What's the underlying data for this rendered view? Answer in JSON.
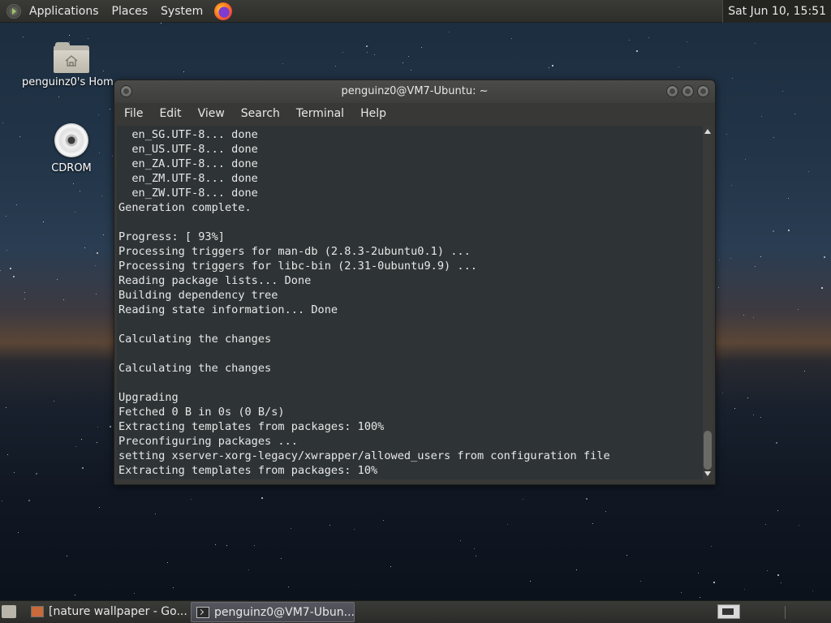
{
  "top_panel": {
    "menus": [
      "Applications",
      "Places",
      "System"
    ],
    "icons": [
      "mint-menu-icon",
      "firefox-icon"
    ],
    "clock": "Sat Jun 10, 15:51"
  },
  "desktop": {
    "icons": [
      {
        "label": "penguinz0's Hom",
        "icon": "home-folder-icon"
      },
      {
        "label": "CDROM",
        "icon": "cdrom-icon"
      }
    ]
  },
  "terminal": {
    "title": "penguinz0@VM7-Ubuntu: ~",
    "menu": [
      "File",
      "Edit",
      "View",
      "Search",
      "Terminal",
      "Help"
    ],
    "lines": [
      "  en_SG.UTF-8... done",
      "  en_US.UTF-8... done",
      "  en_ZA.UTF-8... done",
      "  en_ZM.UTF-8... done",
      "  en_ZW.UTF-8... done",
      "Generation complete.",
      "",
      "Progress: [ 93%]",
      "Processing triggers for man-db (2.8.3-2ubuntu0.1) ...",
      "Processing triggers for libc-bin (2.31-0ubuntu9.9) ...",
      "Reading package lists... Done",
      "Building dependency tree",
      "Reading state information... Done",
      "",
      "Calculating the changes",
      "",
      "Calculating the changes",
      "",
      "Upgrading",
      "Fetched 0 B in 0s (0 B/s)",
      "Extracting templates from packages: 100%",
      "Preconfiguring packages ...",
      "setting xserver-xorg-legacy/xwrapper/allowed_users from configuration file",
      "Extracting templates from packages: 10%"
    ]
  },
  "taskbar": {
    "items": [
      {
        "label": "[nature wallpaper - Go...",
        "icon": "chromium-icon",
        "active": false
      },
      {
        "label": "penguinz0@VM7-Ubun...",
        "icon": "terminal-icon",
        "active": true
      }
    ]
  }
}
